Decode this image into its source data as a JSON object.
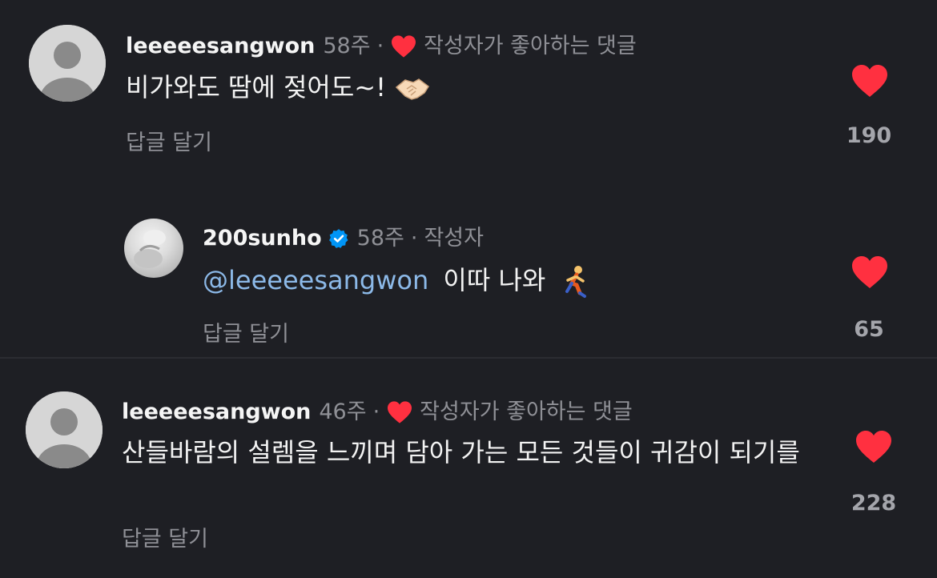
{
  "colors": {
    "background": "#1e1f24",
    "like_red": "#ff3040",
    "mention_blue": "#8cb9e8",
    "verified_blue": "#0095f6",
    "muted_text": "#8f9096"
  },
  "comments": [
    {
      "username": "leeeeesangwon",
      "age": "58주",
      "separator": "·",
      "creator_liked_label": "작성자가 좋아하는 댓글",
      "text": "비가와도 땀에 젖어도~!",
      "emoji_icon": "handshake-icon",
      "reply_label": "답글 달기",
      "like_count": "190",
      "avatar_icon": "default-avatar-icon"
    },
    {
      "username": "200sunho",
      "age": "58주",
      "separator": "·",
      "author_label": "작성자",
      "mention": "@leeeeesangwon",
      "text": "이따 나와",
      "emoji_icon": "running-person-icon",
      "reply_label": "답글 달기",
      "like_count": "65",
      "avatar_icon": "profile-photo"
    },
    {
      "username": "leeeeesangwon",
      "age": "46주",
      "separator": "·",
      "creator_liked_label": "작성자가 좋아하는 댓글",
      "text": "산들바람의 설렘을 느끼며 담아 가는 모든 것들이 귀감이 되기를",
      "reply_label": "답글 달기",
      "like_count": "228",
      "avatar_icon": "default-avatar-icon"
    }
  ]
}
